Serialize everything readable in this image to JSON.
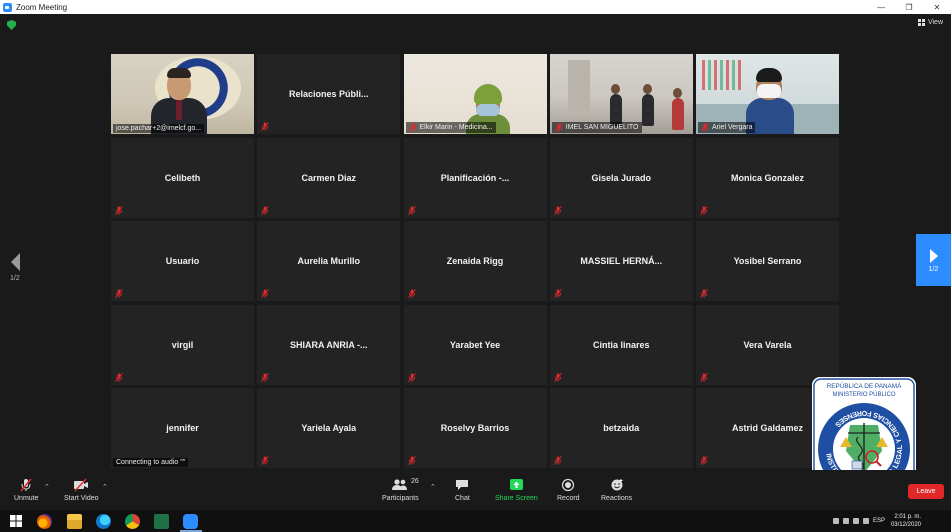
{
  "window": {
    "title": "Zoom Meeting"
  },
  "view_button": {
    "label": "View"
  },
  "pagination": {
    "left_label": "1/2",
    "right_label": "1/2"
  },
  "tiles": [
    {
      "name": "",
      "label": "jose.pachar+2@imelcf.go...",
      "video": "v1",
      "active": true,
      "muted": false
    },
    {
      "name": "Relaciones  Públi...",
      "label": "",
      "video": "",
      "active": false,
      "muted": true
    },
    {
      "name": "",
      "label": "Elkir Marin - Medicina...",
      "video": "v3",
      "active": false,
      "muted": true
    },
    {
      "name": "",
      "label": "IMEL SAN MIGUELITO",
      "video": "v4",
      "active": false,
      "muted": true
    },
    {
      "name": "",
      "label": "Ariel Vergara",
      "video": "v5",
      "active": false,
      "muted": true
    },
    {
      "name": "Celibeth",
      "label": "",
      "video": "",
      "active": false,
      "muted": true
    },
    {
      "name": "Carmen Diaz",
      "label": "",
      "video": "",
      "active": false,
      "muted": true
    },
    {
      "name": "Planificación  -...",
      "label": "",
      "video": "",
      "active": false,
      "muted": true
    },
    {
      "name": "Gisela Jurado",
      "label": "",
      "video": "",
      "active": false,
      "muted": true
    },
    {
      "name": "Monica Gonzalez",
      "label": "",
      "video": "",
      "active": false,
      "muted": true
    },
    {
      "name": "Usuario",
      "label": "",
      "video": "",
      "active": false,
      "muted": true
    },
    {
      "name": "Aurelia Murillo",
      "label": "",
      "video": "",
      "active": false,
      "muted": true
    },
    {
      "name": "Zenaida Rigg",
      "label": "",
      "video": "",
      "active": false,
      "muted": true
    },
    {
      "name": "MASSIEL  HERNÁ...",
      "label": "",
      "video": "",
      "active": false,
      "muted": true
    },
    {
      "name": "Yosibel Serrano",
      "label": "",
      "video": "",
      "active": false,
      "muted": true
    },
    {
      "name": "virgil",
      "label": "",
      "video": "",
      "active": false,
      "muted": true
    },
    {
      "name": "SHIARA  ANRIA  -...",
      "label": "",
      "video": "",
      "active": false,
      "muted": true
    },
    {
      "name": "Yarabet Yee",
      "label": "",
      "video": "",
      "active": false,
      "muted": true
    },
    {
      "name": "Cintia linares",
      "label": "",
      "video": "",
      "active": false,
      "muted": true
    },
    {
      "name": "Vera Varela",
      "label": "",
      "video": "",
      "active": false,
      "muted": true
    },
    {
      "name": "jennifer",
      "label": "Connecting to audio \"\"",
      "video": "",
      "active": false,
      "muted": false
    },
    {
      "name": "Yariela Ayala",
      "label": "",
      "video": "",
      "active": false,
      "muted": true
    },
    {
      "name": "Roselvy Barrios",
      "label": "",
      "video": "",
      "active": false,
      "muted": true
    },
    {
      "name": "betzaida",
      "label": "",
      "video": "",
      "active": false,
      "muted": true
    },
    {
      "name": "Astrid Galdamez",
      "label": "",
      "video": "",
      "active": false,
      "muted": true
    }
  ],
  "logo": {
    "top_line1": "REPÚBLICA DE PANAMÁ",
    "top_line2": "MINISTERIO PÚBLICO",
    "ring_text": "INSTITUTO DE MEDICINA LEGAL Y CIENCIAS FORENSES"
  },
  "toolbar": {
    "unmute": "Unmute",
    "start_video": "Start Video",
    "participants": "Participants",
    "participants_count": "26",
    "chat": "Chat",
    "share_screen": "Share Screen",
    "record": "Record",
    "reactions": "Reactions",
    "leave": "Leave"
  },
  "taskbar": {
    "language": "ESP",
    "time": "2:01 p. m.",
    "date": "03/12/2020"
  },
  "colors": {
    "accent_blue": "#2d8cff",
    "share_green": "#23d959",
    "leave_red": "#e02828",
    "active_speaker": "#c7e53a",
    "muted_red": "#e0292f"
  }
}
